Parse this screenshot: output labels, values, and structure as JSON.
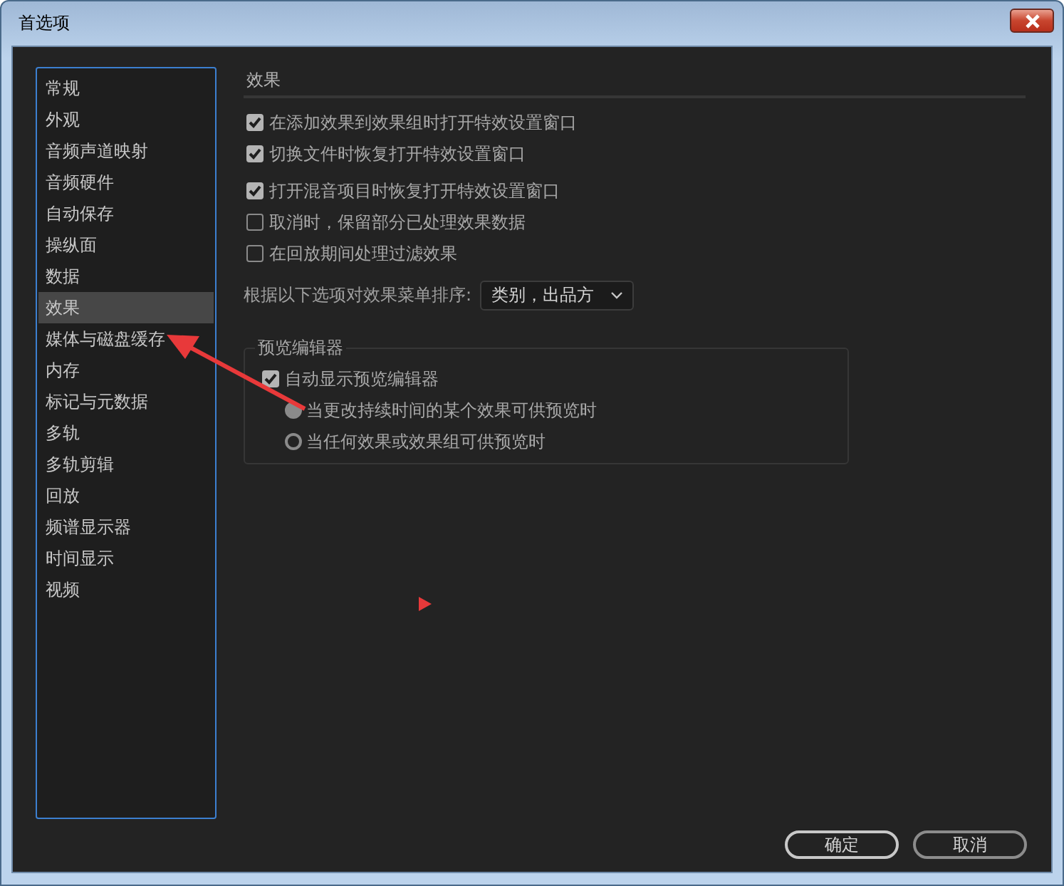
{
  "window": {
    "title": "首选项"
  },
  "sidebar": {
    "items": [
      {
        "label": "常规",
        "selected": false
      },
      {
        "label": "外观",
        "selected": false
      },
      {
        "label": "音频声道映射",
        "selected": false
      },
      {
        "label": "音频硬件",
        "selected": false
      },
      {
        "label": "自动保存",
        "selected": false
      },
      {
        "label": "操纵面",
        "selected": false
      },
      {
        "label": "数据",
        "selected": false
      },
      {
        "label": "效果",
        "selected": true
      },
      {
        "label": "媒体与磁盘缓存",
        "selected": false
      },
      {
        "label": "内存",
        "selected": false
      },
      {
        "label": "标记与元数据",
        "selected": false
      },
      {
        "label": "多轨",
        "selected": false
      },
      {
        "label": "多轨剪辑",
        "selected": false
      },
      {
        "label": "回放",
        "selected": false
      },
      {
        "label": "频谱显示器",
        "selected": false
      },
      {
        "label": "时间显示",
        "selected": false
      },
      {
        "label": "视频",
        "selected": false
      }
    ]
  },
  "section": {
    "title": "效果"
  },
  "options": [
    {
      "label": "在添加效果到效果组时打开特效设置窗口",
      "checked": true
    },
    {
      "label": "切换文件时恢复打开特效设置窗口",
      "checked": true
    },
    {
      "label": "打开混音项目时恢复打开特效设置窗口",
      "checked": true
    },
    {
      "label": "取消时，保留部分已处理效果数据",
      "checked": false
    },
    {
      "label": "在回放期间处理过滤效果",
      "checked": false
    }
  ],
  "sort": {
    "label": "根据以下选项对效果菜单排序:",
    "value": "类别，出品方"
  },
  "preview_group": {
    "title": "预览编辑器",
    "option": {
      "label": "自动显示预览编辑器",
      "checked": true
    },
    "radios": [
      {
        "label": "当更改持续时间的某个效果可供预览时",
        "selected": true
      },
      {
        "label": "当任何效果或效果组可供预览时",
        "selected": false
      }
    ]
  },
  "buttons": [
    "确定",
    "取消"
  ]
}
